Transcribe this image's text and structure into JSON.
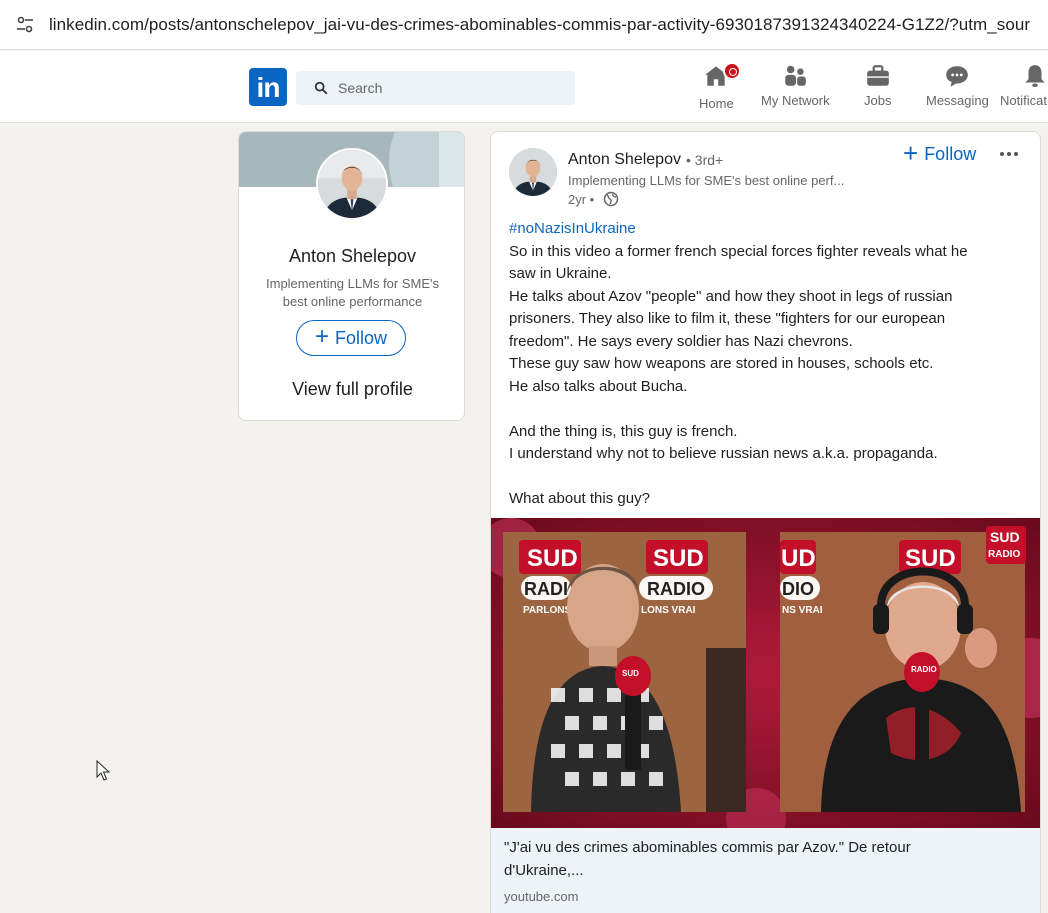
{
  "browser": {
    "url": "linkedin.com/posts/antonschelepov_jai-vu-des-crimes-abominables-commis-par-activity-6930187391324340224-G1Z2/?utm_sour"
  },
  "nav": {
    "logo": "in",
    "search_placeholder": "Search",
    "items": [
      {
        "label": "Home",
        "icon": "home-icon"
      },
      {
        "label": "My Network",
        "icon": "network-icon"
      },
      {
        "label": "Jobs",
        "icon": "jobs-icon"
      },
      {
        "label": "Messaging",
        "icon": "messaging-icon"
      },
      {
        "label": "Notificat",
        "icon": "bell-icon"
      }
    ],
    "colors": {
      "brand": "#0a66c2",
      "badge": "#cc1016"
    }
  },
  "profile": {
    "name": "Anton Shelepov",
    "headline": "Implementing LLMs for SME's best online performance",
    "follow_label": "Follow",
    "view_full_profile": "View full profile"
  },
  "post": {
    "author": "Anton Shelepov",
    "degree": "• 3rd+",
    "headline": "Implementing LLMs for SME's best online perf...",
    "time": "2yr •",
    "follow_label": "Follow",
    "hashtag": "#noNazisInUkraine",
    "lines": [
      "So in this video a former french special forces fighter reveals what he",
      "saw in Ukraine.",
      "He talks about Azov \"people\" and how they shoot in legs of russian",
      "prisoners. They also like to film it, these \"fighters for our european",
      "freedom\". He says every soldier has Nazi chevrons.",
      "These guy saw how weapons are stored in houses, schools etc.",
      "He also talks about Bucha.",
      "",
      "And the thing is, this guy is french.",
      "I understand why not to believe russian news a.k.a. propaganda.",
      "",
      "What about this guy?"
    ],
    "media": {
      "studio_text_left": "SUD",
      "studio_text_left2": "RADI",
      "studio_text_left3": "SUD",
      "studio_text_left4": "RADIO",
      "studio_text_left5": "PARLONS VR",
      "studio_text_left6": "LONS VRAI",
      "studio_text_right": "UD",
      "studio_text_right2": "DIO",
      "studio_text_right3": "NS VRAI",
      "studio_text_right4": "SUD",
      "logo_top": "SUD",
      "logo_bottom": "RADIO",
      "mic_text": "SUD",
      "mic_text2": "RADIO"
    },
    "link": {
      "title": "\"J'ai vu des crimes abominables commis par Azov.\" De retour d'Ukraine,...",
      "source": "youtube.com"
    }
  }
}
